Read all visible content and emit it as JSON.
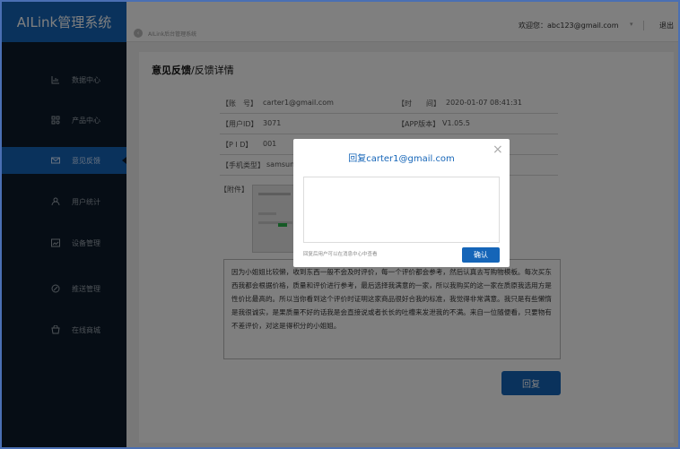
{
  "app": {
    "title": "AILink管理系统"
  },
  "sidebar": {
    "items": [
      {
        "label": "数据中心",
        "icon": "chart-icon"
      },
      {
        "label": "产品中心",
        "icon": "product-icon"
      },
      {
        "label": "意见反馈",
        "icon": "mail-icon",
        "active": true
      },
      {
        "label": "用户统计",
        "icon": "user-icon"
      },
      {
        "label": "设备管理",
        "icon": "device-icon"
      },
      {
        "label": "推送管理",
        "icon": "push-icon"
      },
      {
        "label": "在线商城",
        "icon": "store-icon"
      }
    ]
  },
  "topbar": {
    "back_text": "AILink后台管理系统",
    "welcome": "欢迎您：abc123@gmail.com",
    "logout": "退出"
  },
  "page": {
    "title_bold": "意见反馈",
    "title_rest": "/反馈详情"
  },
  "details": {
    "account_label": "【账　号】",
    "account_value": "carter1@gmail.com",
    "time_label": "【时　　间】",
    "time_value": "2020-01-07 08:41:31",
    "uid_label": "【用户ID】",
    "uid_value": "3071",
    "app_label": "【APP版本】",
    "app_value": "V1.05.5",
    "pid_label": "【P I D】",
    "pid_value": "001",
    "phone_label": "【手机类型】",
    "phone_value": "samsung",
    "attach_label": "【附件】"
  },
  "feedback_text": "因为小姐姐比较懒，收到东西一般不会及时评价，每一个评价都会参考，然后认真去写购物模板。每次买东西我都会根据价格，质量和评价进行参考，最后选择我满意的一家，所以我购买的这一家在质原我选用方是性价比最高的。所以当你看到这个评价时证明这家商品很好合我的标准，我觉得非常满意。我只是有些懒惰是我很诚实，是果质量不好的话我是会直接说或者长长的吐槽来发泄我的不满。来自一位随便看，只要物有不差评价，对这是得积分的小姐姐。",
  "reply_button": "回复",
  "modal": {
    "title": "回复carter1@gmail.com",
    "close": "×",
    "hint": "回复后用户可以在消息中心中查看",
    "ok": "确认"
  }
}
